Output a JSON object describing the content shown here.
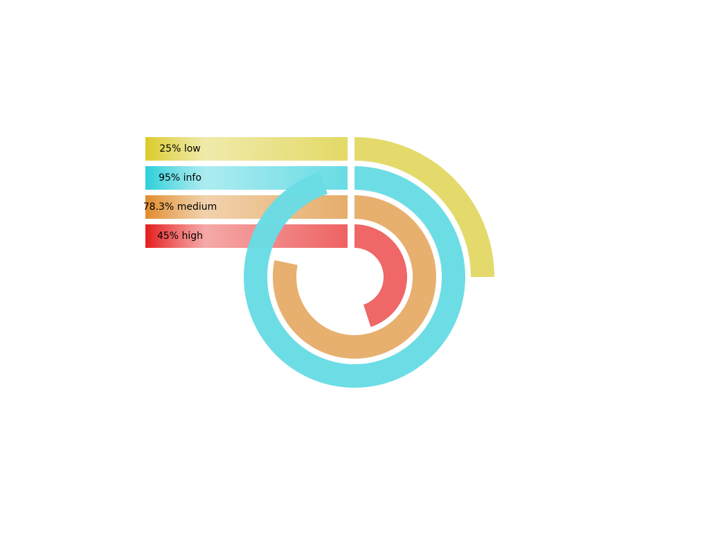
{
  "chart_data": {
    "type": "radial-bar",
    "title": "",
    "series": [
      {
        "label": "25% low",
        "value": 25,
        "color": "#e3d966",
        "gradient_start": "#dccb2a"
      },
      {
        "label": "95% info",
        "value": 95,
        "color": "#68dce4",
        "gradient_start": "#2ccfd9"
      },
      {
        "label": "78.3% medium",
        "value": 78.3,
        "color": "#e6ad6a",
        "gradient_start": "#e18b2c"
      },
      {
        "label": "45% high",
        "value": 45,
        "color": "#ee6262",
        "gradient_start": "#e41c1c"
      }
    ],
    "max": 100,
    "start_angle": "top",
    "direction": "clockwise"
  }
}
